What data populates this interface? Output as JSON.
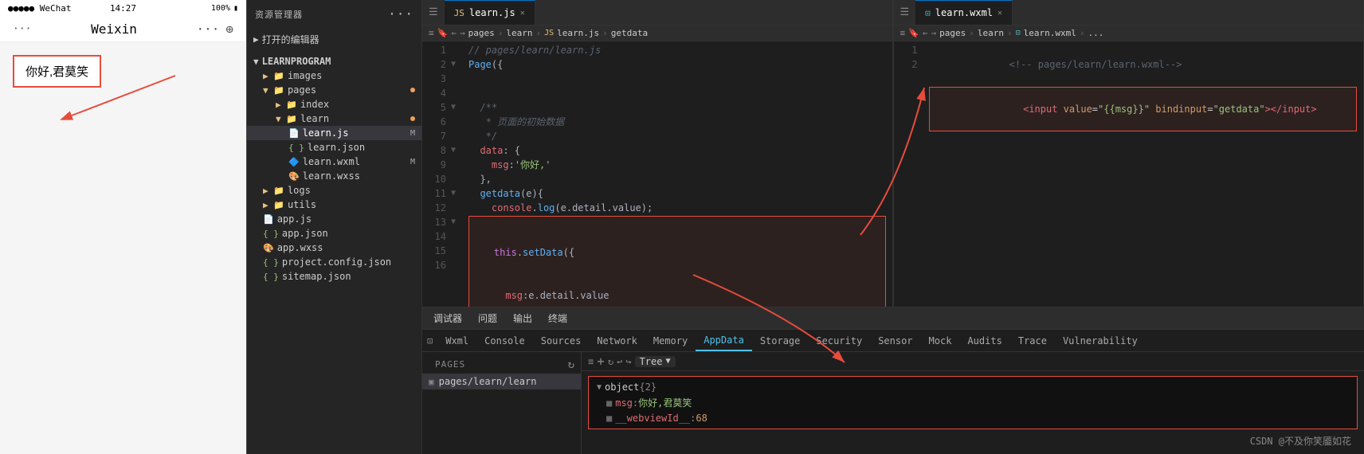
{
  "phone": {
    "status": {
      "carrier": "●●●●● WeChat",
      "time": "14:27",
      "battery": "100%",
      "battery_icon": "▮"
    },
    "nav": {
      "title": "Weixin",
      "back_icon": "···",
      "more_icon": "⊕"
    },
    "content": {
      "greeting": "你好,君莫笑"
    }
  },
  "explorer": {
    "header": "资源管理器",
    "open_editors": "打开的编辑器",
    "project": "LEARNPROGRAM",
    "tree": [
      {
        "label": "images",
        "type": "folder",
        "indent": 1
      },
      {
        "label": "pages",
        "type": "folder",
        "indent": 1,
        "badge": "dot"
      },
      {
        "label": "index",
        "type": "folder",
        "indent": 2
      },
      {
        "label": "learn",
        "type": "folder",
        "indent": 2,
        "badge": "dot"
      },
      {
        "label": "learn.js",
        "type": "js",
        "indent": 3,
        "badge": "M",
        "active": true
      },
      {
        "label": "learn.json",
        "type": "json",
        "indent": 3
      },
      {
        "label": "learn.wxml",
        "type": "wxml",
        "indent": 3,
        "badge": "M"
      },
      {
        "label": "learn.wxss",
        "type": "wxss",
        "indent": 3
      },
      {
        "label": "logs",
        "type": "folder",
        "indent": 1
      },
      {
        "label": "utils",
        "type": "folder",
        "indent": 1
      },
      {
        "label": "app.js",
        "type": "js",
        "indent": 1
      },
      {
        "label": "app.json",
        "type": "json",
        "indent": 1
      },
      {
        "label": "app.wxss",
        "type": "wxss",
        "indent": 1
      },
      {
        "label": "project.config.json",
        "type": "json",
        "indent": 1
      },
      {
        "label": "sitemap.json",
        "type": "json",
        "indent": 1
      }
    ]
  },
  "editor_left": {
    "tab": "learn.js",
    "breadcrumb": "pages > learn > learn.js > getdata",
    "header_comment": "// pages/learn/learn.js",
    "lines": [
      {
        "num": 1,
        "code": "// pages/learn/learn.js"
      },
      {
        "num": 2,
        "code": "Page({"
      },
      {
        "num": 3,
        "code": ""
      },
      {
        "num": 4,
        "code": ""
      },
      {
        "num": 5,
        "code": "  /**"
      },
      {
        "num": 6,
        "code": "   * 页面的初始数据"
      },
      {
        "num": 7,
        "code": "   */"
      },
      {
        "num": 8,
        "code": "  data: {"
      },
      {
        "num": 9,
        "code": "    msg:'你好,'"
      },
      {
        "num": 10,
        "code": "  },"
      },
      {
        "num": 11,
        "code": "  getdata(e){"
      },
      {
        "num": 12,
        "code": "    console.log(e.detail.value);"
      },
      {
        "num": 13,
        "code": "    this.setData({"
      },
      {
        "num": 14,
        "code": "      msg:e.detail.value"
      },
      {
        "num": 15,
        "code": "    })"
      },
      {
        "num": 16,
        "code": "  }"
      }
    ]
  },
  "editor_right": {
    "tab": "learn.wxml",
    "breadcrumb": "pages > learn > learn.wxml > ...",
    "lines": [
      {
        "num": 1,
        "code": "<!-- pages/learn/learn.wxml-->"
      },
      {
        "num": 2,
        "code": "<input value=\"{{msg}}\" bindinput=\"getdata\"></input>"
      }
    ]
  },
  "debug": {
    "toolbar_items": [
      "调试器",
      "问题",
      "输出",
      "终端"
    ],
    "tabs": [
      "Wxml",
      "Console",
      "Sources",
      "Network",
      "Memory",
      "AppData",
      "Storage",
      "Security",
      "Sensor",
      "Mock",
      "Audits",
      "Trace",
      "Vulnerability"
    ],
    "active_tab": "AppData",
    "pages_header": "Pages",
    "pages": [
      {
        "label": "pages/learn/learn",
        "active": true
      }
    ],
    "tree_label": "Tree",
    "data": {
      "type": "object",
      "count": 2,
      "fields": [
        {
          "key": "msg",
          "value": "你好,君莫笑"
        },
        {
          "key": "__webviewId__",
          "value": "68"
        }
      ]
    }
  },
  "watermark": "CSDN @不及你笑靥如花"
}
